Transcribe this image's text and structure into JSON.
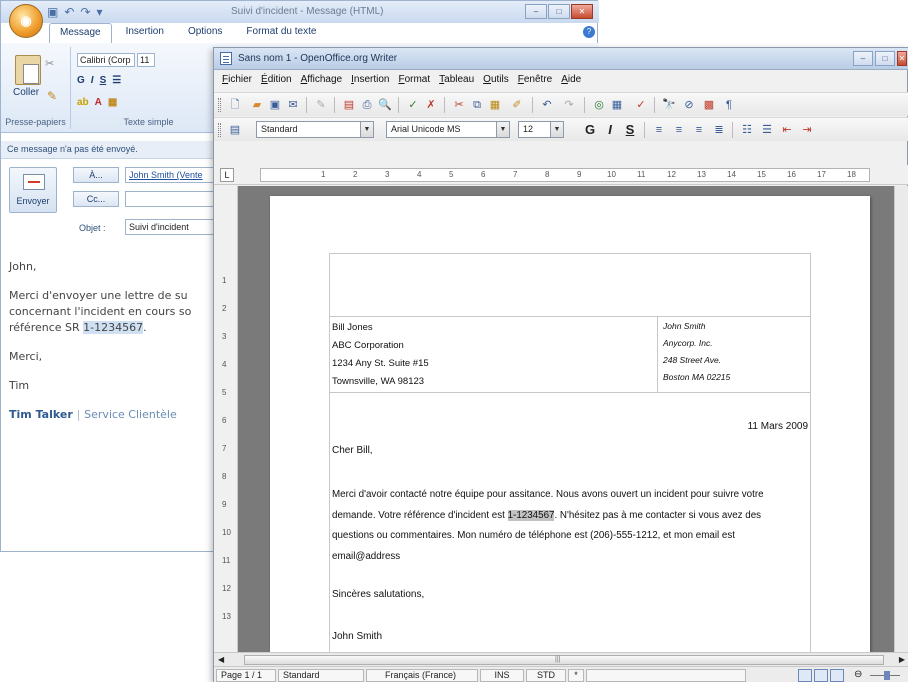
{
  "outlook": {
    "qat_icons": [
      "save-icon",
      "undo-icon",
      "redo-icon"
    ],
    "window_title": "Suivi d'incident - Message (HTML)",
    "tabs": [
      {
        "label": "Message",
        "active": true
      },
      {
        "label": "Insertion",
        "active": false
      },
      {
        "label": "Options",
        "active": false
      },
      {
        "label": "Format du texte",
        "active": false
      }
    ],
    "ribbon": {
      "paste_label": "Coller",
      "clipboard_label": "Presse-papiers",
      "font_name": "Calibri (Corp",
      "font_size": "11",
      "font_group_label": "Texte simple"
    },
    "info_bar": "Ce message n'a pas été envoyé.",
    "send_label": "Envoyer",
    "to_button": "À...",
    "cc_button": "Cc...",
    "to_value": "John Smith (Vente",
    "cc_value": "",
    "subject_label": "Objet :",
    "subject_value": "Suivi d'incident",
    "body": {
      "greeting": "John,",
      "para_line1": "Merci d'envoyer une lettre de su",
      "para_line2": "concernant l'incident en cours so",
      "para_line3_prefix": "référence SR ",
      "para_ref": "1-1234567",
      "para_line3_suffix": ".",
      "thanks": "Merci,",
      "name": "Tim",
      "sig_name": "Tim Talker",
      "sig_sep": "|",
      "sig_service": "Service Clientèle"
    }
  },
  "writer": {
    "window_title": "Sans nom 1 - OpenOffice.org Writer",
    "menus": [
      "Fichier",
      "Édition",
      "Affichage",
      "Insertion",
      "Format",
      "Tableau",
      "Outils",
      "Fenêtre",
      "Aide"
    ],
    "toolbar": {
      "paragraph_style": "Standard",
      "font_name": "Arial Unicode MS",
      "font_size": "12",
      "bold": "G",
      "italic": "I",
      "underline": "S"
    },
    "ruler_ticks": [
      "1",
      "2",
      "3",
      "4",
      "5",
      "6",
      "7",
      "8",
      "9",
      "10",
      "11",
      "12",
      "13",
      "14",
      "15",
      "16",
      "17",
      "18"
    ],
    "vruler_ticks": [
      "1",
      "2",
      "3",
      "4",
      "5",
      "6",
      "7",
      "8",
      "9",
      "10",
      "11",
      "12",
      "13"
    ],
    "letter": {
      "sender": [
        "Bill Jones",
        "ABC Corporation",
        "1234 Any St. Suite #15",
        "Townsville, WA 98123"
      ],
      "recipient": [
        "John Smith",
        "Anycorp. Inc.",
        "248 Street Ave.",
        "Boston MA 02215"
      ],
      "date": "11 Mars 2009",
      "salutation": "Cher Bill,",
      "para_before": "Merci d'avoir contacté notre équipe pour assitance. Nous avons ouvert un incident pour suivre votre demande. Votre référence d'incident est ",
      "para_ref": "1-1234567",
      "para_after": ". N'hésitez pas à me contacter si vous avez des questions ou commentaires. Mon numéro de téléphone est (206)-555-1212, et mon email est email@address",
      "closing": "Sincères salutations,",
      "signature": "John Smith"
    },
    "status": {
      "page": "Page 1 / 1",
      "style": "Standard",
      "language": "Français (France)",
      "insert_mode": "INS",
      "selection_mode": "STD",
      "modified": "*"
    }
  },
  "colors": {
    "ribbon_blue": "#dde8f6",
    "title_blue": "#b9cde6",
    "workspace_gray": "#7a7a7a",
    "signature_blue": "#2f5a8f",
    "highlight_gray": "#c2c2c2"
  }
}
